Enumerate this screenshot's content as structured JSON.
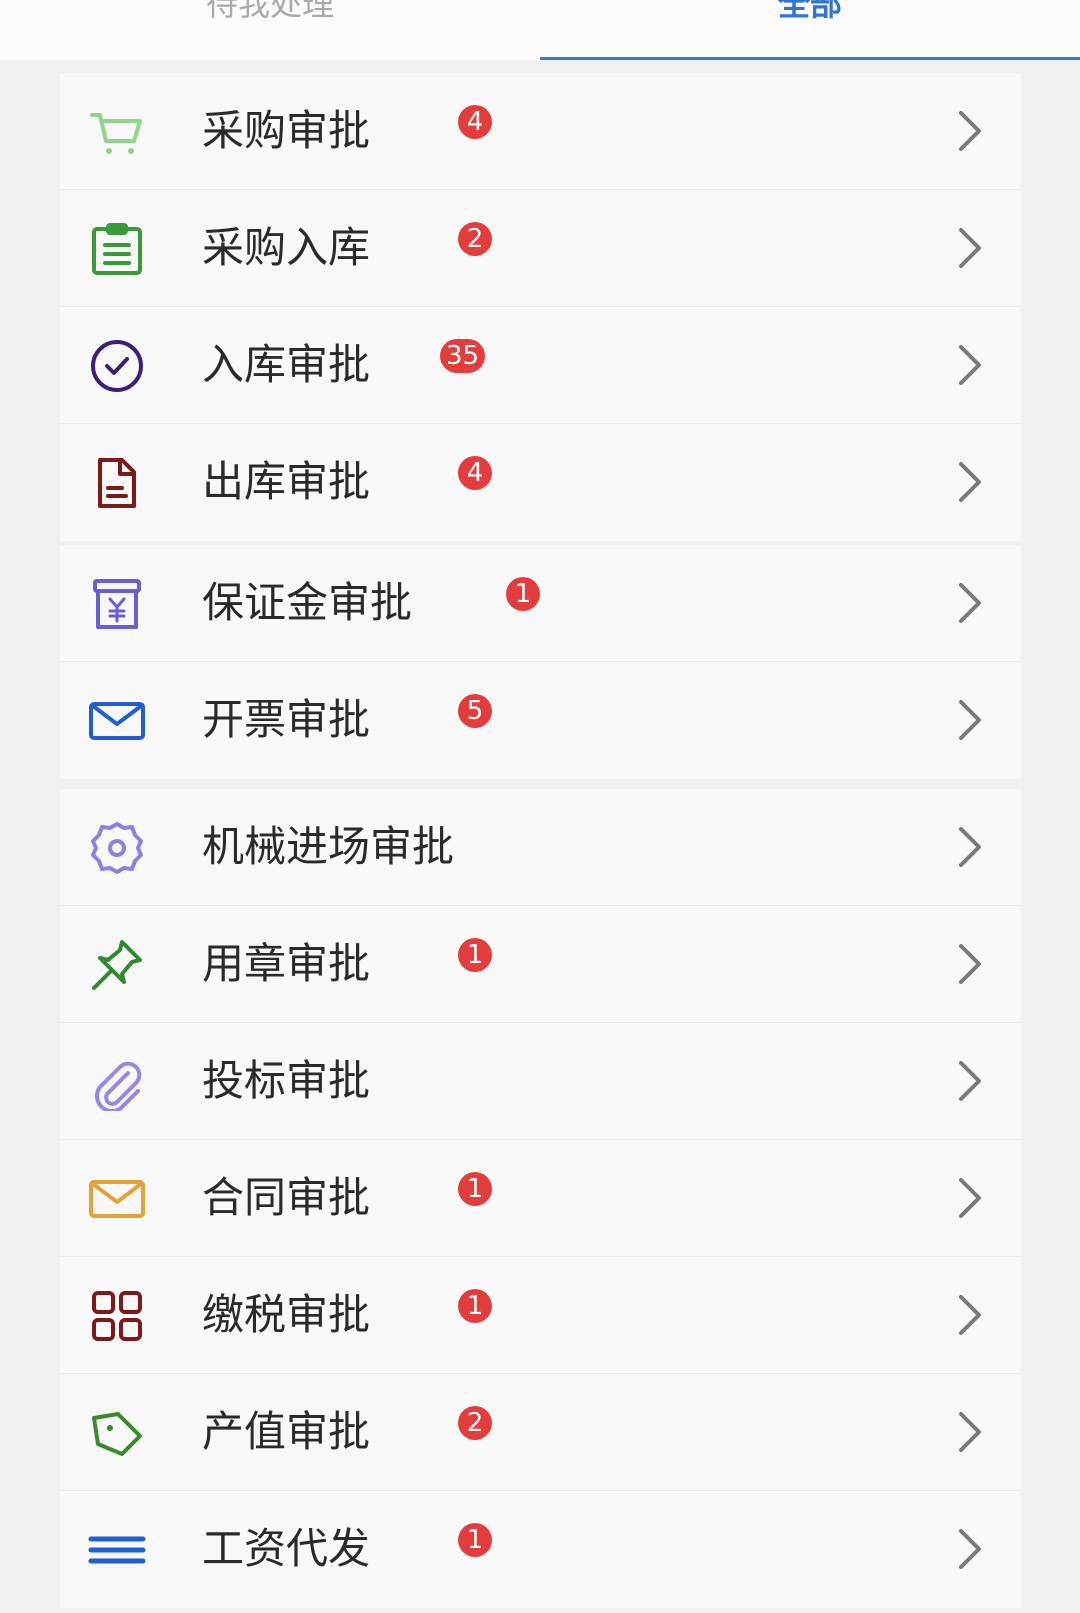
{
  "tabs": [
    {
      "label": "待我处理",
      "active": false
    },
    {
      "label": "全部",
      "active": true
    }
  ],
  "accent_color": "#2f73d3",
  "badge_color": "#e23c3c",
  "groups": [
    {
      "items": [
        {
          "label": "采购审批",
          "badge": "4",
          "icon": "shopping-cart-icon",
          "icon_color": "#8fd48a"
        },
        {
          "label": "采购入库",
          "badge": "2",
          "icon": "clipboard-list-icon",
          "icon_color": "#3a9a3a"
        },
        {
          "label": "入库审批",
          "badge": "35",
          "icon": "check-circle-icon",
          "icon_color": "#3c1f7a"
        },
        {
          "label": "出库审批",
          "badge": "4",
          "icon": "document-icon",
          "icon_color": "#7a1a1a"
        }
      ]
    },
    {
      "items": [
        {
          "label": "保证金审批",
          "badge": "1",
          "icon": "yuan-box-icon",
          "icon_color": "#6a5fd0"
        },
        {
          "label": "开票审批",
          "badge": "5",
          "icon": "envelope-icon",
          "icon_color": "#1f5fcf"
        }
      ]
    },
    {
      "items": [
        {
          "label": "机械进场审批",
          "badge": "",
          "icon": "gear-icon",
          "icon_color": "#8f7fe0"
        },
        {
          "label": "用章审批",
          "badge": "1",
          "icon": "pin-icon",
          "icon_color": "#2f8a2f"
        },
        {
          "label": "投标审批",
          "badge": "",
          "icon": "paperclip-icon",
          "icon_color": "#9a86e0"
        },
        {
          "label": "合同审批",
          "badge": "1",
          "icon": "envelope-icon",
          "icon_color": "#e2a43a"
        },
        {
          "label": "缴税审批",
          "badge": "1",
          "icon": "grid-icon",
          "icon_color": "#7a1a1a"
        },
        {
          "label": "产值审批",
          "badge": "2",
          "icon": "tag-icon",
          "icon_color": "#3a8a2a"
        },
        {
          "label": "工资代发",
          "badge": "1",
          "icon": "menu-lines-icon",
          "icon_color": "#1f5fcf"
        }
      ]
    }
  ]
}
